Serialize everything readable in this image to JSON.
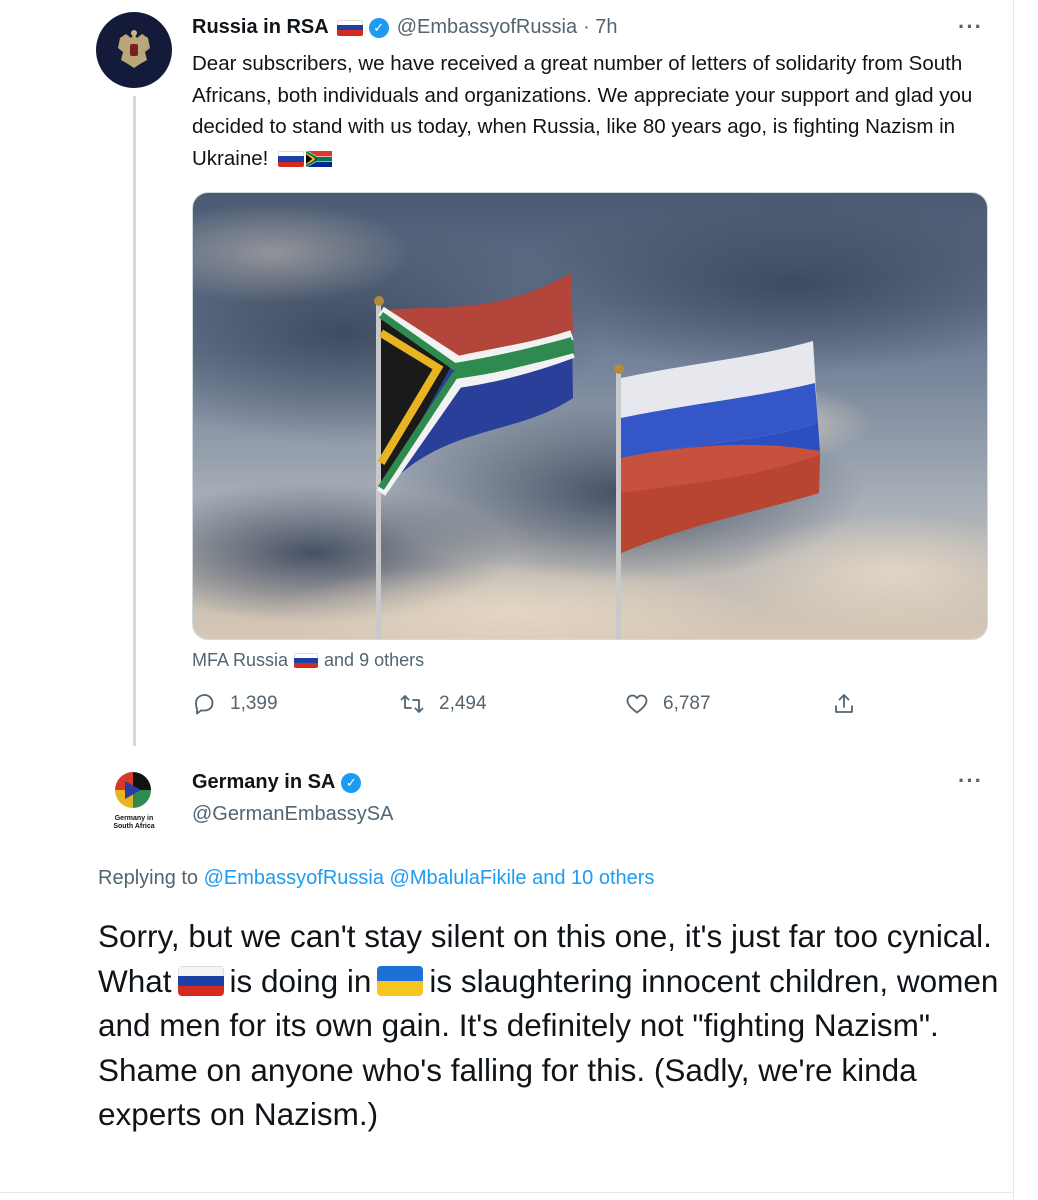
{
  "tweet1": {
    "name": "Russia in RSA",
    "handle": "@EmbassyofRussia",
    "time": "· 7h",
    "text_part1": "Dear subscribers, we have received a great number of letters of solidarity from South Africans, both individuals and organizations. We appreciate your support and glad you decided to stand with us today, when Russia, like 80 years ago, is fighting Nazism in Ukraine!",
    "likers_name": "MFA Russia",
    "likers_rest": "and 9 others",
    "replies": "1,399",
    "retweets": "2,494",
    "likes": "6,787",
    "more_label": "···"
  },
  "tweet2": {
    "name": "Germany in SA",
    "handle": "@GermanEmbassySA",
    "avatar_caption": "Germany in South Africa",
    "replying_prefix": "Replying to",
    "replying_links": "@EmbassyofRussia @MbalulaFikile and 10 others",
    "text_a": "Sorry, but we can't stay silent on this one, it's just far too cynical. What",
    "text_b": "is doing in",
    "text_c": "is slaughtering innocent children, women and men for its own gain. It's definitely not \"fighting Nazism\". Shame on anyone who's falling for this. (Sadly, we're kinda experts on Nazism.)",
    "more_label": "···"
  },
  "icons": [
    "reply-icon",
    "retweet-icon",
    "like-icon",
    "share-icon",
    "verified-badge-icon",
    "more-icon"
  ],
  "colors": {
    "accent": "#1d9bf0",
    "muted": "#536471",
    "text": "#0f1419"
  }
}
